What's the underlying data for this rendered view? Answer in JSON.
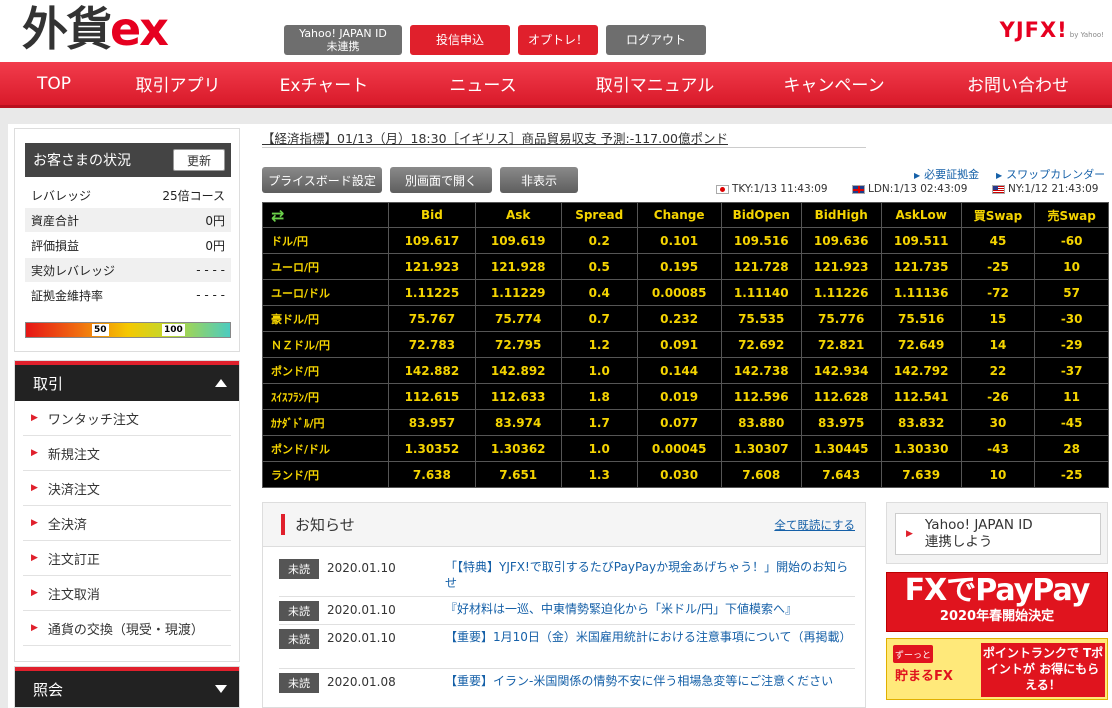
{
  "header": {
    "logo_main": "外貨",
    "logo_ex": "ex",
    "yahoo_id_line1": "Yahoo! JAPAN ID",
    "yahoo_id_line2": "未連携",
    "apply_label": "投信申込",
    "optrade_label": "オプトレ！",
    "logout_label": "ログアウト",
    "brand": "YJFX!",
    "brand_sub": "by Yahoo!"
  },
  "nav": {
    "items": [
      "TOP",
      "取引アプリ",
      "Exチャート",
      "ニュース",
      "取引マニュアル",
      "キャンペーン",
      "お問い合わせ"
    ]
  },
  "status": {
    "title": "お客さまの状況",
    "update_label": "更新",
    "rows": [
      {
        "label": "レバレッジ",
        "value": "25倍コース"
      },
      {
        "label": "資産合計",
        "value": "0円"
      },
      {
        "label": "評価損益",
        "value": "0円"
      },
      {
        "label": "実効レバレッジ",
        "value": "- - - -"
      },
      {
        "label": "証拠金維持率",
        "value": "- - - -"
      }
    ],
    "gauge_mid": "50",
    "gauge_high": "100"
  },
  "trade_menu": {
    "title": "取引",
    "items": [
      "ワンタッチ注文",
      "新規注文",
      "決済注文",
      "全決済",
      "注文訂正",
      "注文取消",
      "通貨の交換（現受・現渡）"
    ]
  },
  "inquiry_menu": {
    "title": "照会"
  },
  "ticker": {
    "text": "【経済指標】01/13（月）18:30［イギリス］商品貿易収支 予測:-117.00億ポンド"
  },
  "board_controls": {
    "settings_label": "プライスボード設定",
    "open_window_label": "別画面で開く",
    "hide_label": "非表示",
    "margin_link": "必要証拠金",
    "swap_link": "スワップカレンダー",
    "tky": "TKY:1/13 11:43:09",
    "ldn": "LDN:1/13 02:43:09",
    "ny": "NY:1/12 21:43:09"
  },
  "price_board": {
    "headers": [
      "Bid",
      "Ask",
      "Spread",
      "Change",
      "BidOpen",
      "BidHigh",
      "AskLow",
      "買Swap",
      "売Swap"
    ],
    "rows": [
      {
        "pair": "ドル/円",
        "bid": "109.617",
        "ask": "109.619",
        "spread": "0.2",
        "change": "0.101",
        "open": "109.516",
        "high": "109.636",
        "low": "109.511",
        "buy_swap": "45",
        "sell_swap": "-60"
      },
      {
        "pair": "ユーロ/円",
        "bid": "121.923",
        "ask": "121.928",
        "spread": "0.5",
        "change": "0.195",
        "open": "121.728",
        "high": "121.923",
        "low": "121.735",
        "buy_swap": "-25",
        "sell_swap": "10"
      },
      {
        "pair": "ユーロ/ドル",
        "bid": "1.11225",
        "ask": "1.11229",
        "spread": "0.4",
        "change": "0.00085",
        "open": "1.11140",
        "high": "1.11226",
        "low": "1.11136",
        "buy_swap": "-72",
        "sell_swap": "57"
      },
      {
        "pair": "豪ドル/円",
        "bid": "75.767",
        "ask": "75.774",
        "spread": "0.7",
        "change": "0.232",
        "open": "75.535",
        "high": "75.776",
        "low": "75.516",
        "buy_swap": "15",
        "sell_swap": "-30"
      },
      {
        "pair": "ＮＺドル/円",
        "bid": "72.783",
        "ask": "72.795",
        "spread": "1.2",
        "change": "0.091",
        "open": "72.692",
        "high": "72.821",
        "low": "72.649",
        "buy_swap": "14",
        "sell_swap": "-29"
      },
      {
        "pair": "ポンド/円",
        "bid": "142.882",
        "ask": "142.892",
        "spread": "1.0",
        "change": "0.144",
        "open": "142.738",
        "high": "142.934",
        "low": "142.792",
        "buy_swap": "22",
        "sell_swap": "-37"
      },
      {
        "pair": "ｽｲｽﾌﾗﾝ/円",
        "bid": "112.615",
        "ask": "112.633",
        "spread": "1.8",
        "change": "0.019",
        "open": "112.596",
        "high": "112.628",
        "low": "112.541",
        "buy_swap": "-26",
        "sell_swap": "11"
      },
      {
        "pair": "ｶﾅﾀﾞﾄﾞﾙ/円",
        "bid": "83.957",
        "ask": "83.974",
        "spread": "1.7",
        "change": "0.077",
        "open": "83.880",
        "high": "83.975",
        "low": "83.832",
        "buy_swap": "30",
        "sell_swap": "-45"
      },
      {
        "pair": "ポンド/ドル",
        "bid": "1.30352",
        "ask": "1.30362",
        "spread": "1.0",
        "change": "0.00045",
        "open": "1.30307",
        "high": "1.30445",
        "low": "1.30330",
        "buy_swap": "-43",
        "sell_swap": "28"
      },
      {
        "pair": "ランド/円",
        "bid": "7.638",
        "ask": "7.651",
        "spread": "1.3",
        "change": "0.030",
        "open": "7.608",
        "high": "7.643",
        "low": "7.639",
        "buy_swap": "10",
        "sell_swap": "-25"
      }
    ]
  },
  "news": {
    "title": "お知らせ",
    "read_all_label": "全て既読にする",
    "badge": "未読",
    "items": [
      {
        "date": "2020.01.10",
        "text": "「【特典】YJFX!で取引するたびPayPayか現金あげちゃう！」開始のお知らせ"
      },
      {
        "date": "2020.01.10",
        "text": "『好材料は一巡、中東情勢緊迫化から「米ドル/円」下値模索へ』"
      },
      {
        "date": "2020.01.10",
        "text": "【重要】1月10日（金）米国雇用統計における注意事項について（再掲載）"
      },
      {
        "date": "2020.01.08",
        "text": "【重要】イラン-米国関係の情勢不安に伴う相場急変等にご注意ください"
      }
    ]
  },
  "right": {
    "yahoo_link_line1": "Yahoo! JAPAN ID",
    "yahoo_link_line2": "連携しよう",
    "banner1_big": "FXでPayPay",
    "banner1_small": "2020年春開始決定",
    "banner2_tag": "ずーっと",
    "banner2_l1": "貯まるFX",
    "banner2_l2": "ポイントランクで Tポイントが お得にもらえる！"
  }
}
